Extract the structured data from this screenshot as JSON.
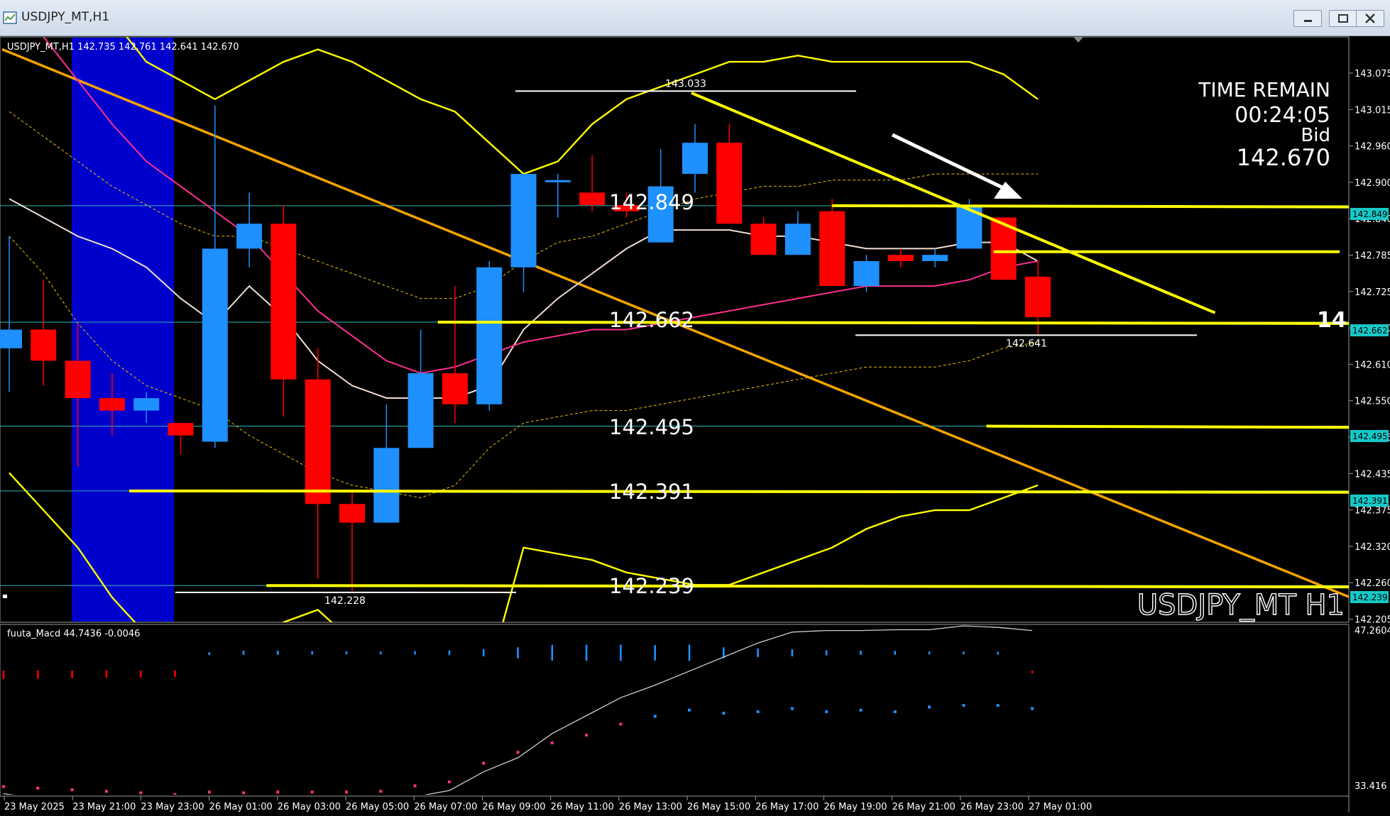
{
  "window": {
    "title": "USDJPY_MT,H1",
    "buttons": [
      "minimize",
      "maximize",
      "close"
    ]
  },
  "info": {
    "header": "USDJPY_MT,H1  142.735 142.761 142.641 142.670",
    "time_remain_label": "TIME REMAIN",
    "time_remain": "00:24:05",
    "bid_label": "Bid",
    "bid": "142.670",
    "watermark": "USDJPY_MT H1",
    "right_cut_label": "14"
  },
  "colors": {
    "bull": "#1e90ff",
    "bear": "#ff0000",
    "trend": "#ffff00",
    "diag": "#f5a300",
    "grid_h": "#2ab7b7",
    "ma_white": "#f2dcd0",
    "ma_pink": "#ff2f92",
    "band": "#e8c100",
    "session": "#0000cc"
  },
  "chart_data": [
    {
      "type": "candlestick",
      "symbol": "USDJPY_MT",
      "timeframe": "H1",
      "ylim": [
        142.18,
        143.12
      ],
      "y_ticks": [
        "143.075",
        "143.015",
        "142.960",
        "142.900",
        "142.840",
        "142.785",
        "142.725",
        "142.670",
        "142.610",
        "142.550",
        "142.495",
        "142.435",
        "142.375",
        "142.320",
        "142.260",
        "142.205"
      ],
      "right_tags": [
        "142.849",
        "142.662",
        "142.495",
        "142.391",
        "142.239"
      ],
      "x_labels": [
        "23 May 2025",
        "23 May 21:00",
        "23 May 23:00",
        "26 May 01:00",
        "26 May 03:00",
        "26 May 05:00",
        "26 May 07:00",
        "26 May 09:00",
        "26 May 11:00",
        "26 May 13:00",
        "26 May 15:00",
        "26 May 17:00",
        "26 May 19:00",
        "26 May 21:00",
        "26 May 23:00",
        "27 May 01:00"
      ],
      "candles": [
        {
          "o": 142.62,
          "h": 142.8,
          "l": 142.55,
          "c": 142.65
        },
        {
          "o": 142.65,
          "h": 142.73,
          "l": 142.56,
          "c": 142.6
        },
        {
          "o": 142.6,
          "h": 142.66,
          "l": 142.43,
          "c": 142.54
        },
        {
          "o": 142.54,
          "h": 142.58,
          "l": 142.48,
          "c": 142.52
        },
        {
          "o": 142.52,
          "h": 142.55,
          "l": 142.5,
          "c": 142.54
        },
        {
          "o": 142.5,
          "h": 142.5,
          "l": 142.45,
          "c": 142.48
        },
        {
          "o": 142.47,
          "h": 143.01,
          "l": 142.46,
          "c": 142.78
        },
        {
          "o": 142.78,
          "h": 142.87,
          "l": 142.75,
          "c": 142.82
        },
        {
          "o": 142.82,
          "h": 142.85,
          "l": 142.51,
          "c": 142.57
        },
        {
          "o": 142.57,
          "h": 142.62,
          "l": 142.25,
          "c": 142.37
        },
        {
          "o": 142.37,
          "h": 142.39,
          "l": 142.23,
          "c": 142.34
        },
        {
          "o": 142.34,
          "h": 142.53,
          "l": 142.34,
          "c": 142.46
        },
        {
          "o": 142.46,
          "h": 142.65,
          "l": 142.46,
          "c": 142.58
        },
        {
          "o": 142.58,
          "h": 142.72,
          "l": 142.5,
          "c": 142.53
        },
        {
          "o": 142.53,
          "h": 142.76,
          "l": 142.52,
          "c": 142.75
        },
        {
          "o": 142.75,
          "h": 142.9,
          "l": 142.71,
          "c": 142.9
        },
        {
          "o": 142.89,
          "h": 142.9,
          "l": 142.83,
          "c": 142.89
        },
        {
          "o": 142.87,
          "h": 142.93,
          "l": 142.84,
          "c": 142.85
        },
        {
          "o": 142.85,
          "h": 142.87,
          "l": 142.83,
          "c": 142.84
        },
        {
          "o": 142.79,
          "h": 142.94,
          "l": 142.81,
          "c": 142.88
        },
        {
          "o": 142.9,
          "h": 142.98,
          "l": 142.87,
          "c": 142.95
        },
        {
          "o": 142.95,
          "h": 142.98,
          "l": 142.82,
          "c": 142.82
        },
        {
          "o": 142.82,
          "h": 142.83,
          "l": 142.77,
          "c": 142.77
        },
        {
          "o": 142.77,
          "h": 142.84,
          "l": 142.77,
          "c": 142.82
        },
        {
          "o": 142.84,
          "h": 142.86,
          "l": 142.72,
          "c": 142.72
        },
        {
          "o": 142.72,
          "h": 142.77,
          "l": 142.71,
          "c": 142.76
        },
        {
          "o": 142.77,
          "h": 142.78,
          "l": 142.75,
          "c": 142.76
        },
        {
          "o": 142.76,
          "h": 142.78,
          "l": 142.75,
          "c": 142.77
        },
        {
          "o": 142.78,
          "h": 142.86,
          "l": 142.78,
          "c": 142.85
        },
        {
          "o": 142.83,
          "h": 142.83,
          "l": 142.73,
          "c": 142.73
        },
        {
          "o": 142.735,
          "h": 142.761,
          "l": 142.641,
          "c": 142.67
        }
      ],
      "ma_white": [
        142.86,
        142.83,
        142.8,
        142.78,
        142.75,
        142.7,
        142.66,
        142.72,
        142.67,
        142.6,
        142.56,
        142.54,
        142.54,
        142.54,
        142.56,
        142.65,
        142.7,
        142.74,
        142.78,
        142.81,
        142.81,
        142.81,
        142.8,
        142.8,
        142.79,
        142.78,
        142.78,
        142.78,
        142.79,
        142.79,
        142.76
      ],
      "ma_pink": [
        143.2,
        143.12,
        143.05,
        142.98,
        142.92,
        142.88,
        142.84,
        142.8,
        142.74,
        142.68,
        142.64,
        142.6,
        142.58,
        142.59,
        142.61,
        142.63,
        142.64,
        142.65,
        142.65,
        142.66,
        142.67,
        142.68,
        142.69,
        142.7,
        142.71,
        142.72,
        142.72,
        142.72,
        142.73,
        142.75,
        142.76
      ],
      "price_levels": [
        {
          "value": 142.849,
          "label": "142.849",
          "from": 24,
          "to": 40
        },
        {
          "value": 142.662,
          "label": "142.662",
          "from": 12.5,
          "to": 40
        },
        {
          "value": 142.495,
          "label": "142.495",
          "from": 28.5,
          "to": 40
        },
        {
          "value": 142.391,
          "label": "142.391",
          "from": 3.5,
          "to": 40
        },
        {
          "value": 142.239,
          "label": "142.239",
          "from": 7.5,
          "to": 40
        }
      ],
      "second_level": {
        "value": 142.775,
        "from": 29,
        "to": 39
      },
      "high_mark": {
        "value": 143.033,
        "label": "143.033",
        "from": 15,
        "to": 25
      },
      "low_mark": {
        "value": 142.641,
        "label": "142.641",
        "from": 25,
        "to": 35
      },
      "low_mark_2": {
        "value": 142.228,
        "label": "142.228",
        "from": 5,
        "to": 15
      },
      "yellow_downtrend": {
        "x1": 20,
        "y1": 143.03,
        "x2": 35,
        "y2": 142.677
      },
      "orange_diagonal": {
        "x1": 0,
        "y1": 143.1,
        "x2": 40,
        "y2": 142.2
      }
    },
    {
      "type": "histogram",
      "name": "fuuta_Macd",
      "values_label": "44.7436  -0.0046",
      "title_label": "fuuta_Macd 44.7436  -0.0046",
      "y_ticks": [
        "47.2604",
        "33.416"
      ],
      "hist": [
        -0.4,
        -0.38,
        -0.36,
        -0.34,
        -0.32,
        -0.3,
        0.06,
        0.2,
        0.2,
        0.16,
        0.14,
        0.12,
        0.16,
        0.22,
        0.34,
        0.52,
        0.74,
        0.76,
        0.76,
        0.72,
        0.76,
        0.52,
        0.4,
        0.34,
        0.24,
        0.2,
        0.18,
        0.12,
        0.12,
        0.1,
        -0.08
      ],
      "signal": [
        -0.86,
        -0.88,
        -0.9,
        -0.92,
        -0.94,
        -0.96,
        -0.93,
        -0.94,
        -0.93,
        -0.93,
        -0.93,
        -0.92,
        -0.85,
        -0.8,
        -0.56,
        -0.42,
        -0.3,
        -0.2,
        -0.06,
        0.04,
        0.12,
        0.08,
        0.1,
        0.14,
        0.1,
        0.12,
        0.1,
        0.16,
        0.18,
        0.18,
        0.14
      ],
      "macd_line": [
        -1.35,
        -1.41,
        -1.47,
        -1.52,
        -1.57,
        -1.62,
        -1.44,
        -1.43,
        -1.43,
        -1.44,
        -1.46,
        -1.45,
        -1.39,
        -1.31,
        -1.07,
        -0.89,
        -0.58,
        -0.35,
        -0.12,
        0.04,
        0.22,
        0.4,
        0.58,
        0.72,
        0.74,
        0.74,
        0.75,
        0.75,
        0.8,
        0.78,
        0.74
      ]
    }
  ]
}
